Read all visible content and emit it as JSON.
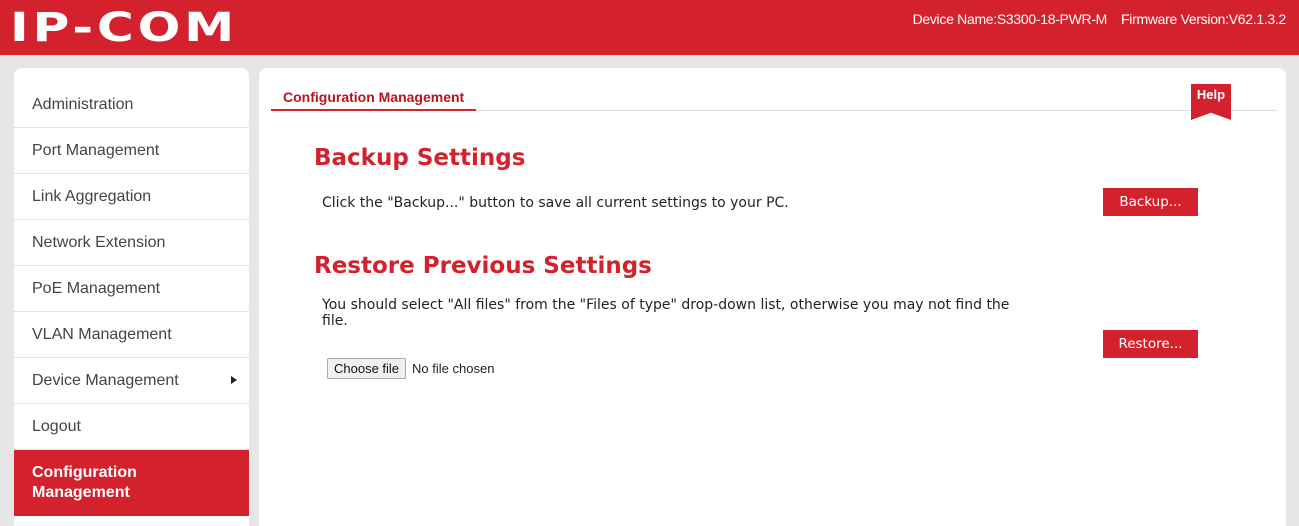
{
  "colors": {
    "brand_red": "#d3212d",
    "background": "#e6e6e6",
    "panel": "#ffffff"
  },
  "header": {
    "logo_text": "IP-COM",
    "device_name": "Device Name:S3300-18-PWR-M",
    "firmware_version": "Firmware Version:V62.1.3.2"
  },
  "sidebar": {
    "items": [
      {
        "label": "Administration"
      },
      {
        "label": "Port Management"
      },
      {
        "label": "Link Aggregation"
      },
      {
        "label": "Network Extension"
      },
      {
        "label": "PoE Management"
      },
      {
        "label": "VLAN Management"
      },
      {
        "label": "Device Management",
        "has_submenu": true
      },
      {
        "label": "Logout"
      },
      {
        "label": "Configuration Management",
        "active": true
      }
    ]
  },
  "main": {
    "tab_label": "Configuration Management",
    "help_label": "Help",
    "backup": {
      "title": "Backup Settings",
      "description": "Click the \"Backup...\" button to save all current settings to your PC.",
      "button_label": "Backup..."
    },
    "restore": {
      "title": "Restore Previous Settings",
      "description": "You should select \"All files\" from the \"Files of type\" drop-down list, otherwise you may not find the file.",
      "choose_file_label": "Choose file",
      "file_status": "No file chosen",
      "button_label": "Restore..."
    }
  }
}
